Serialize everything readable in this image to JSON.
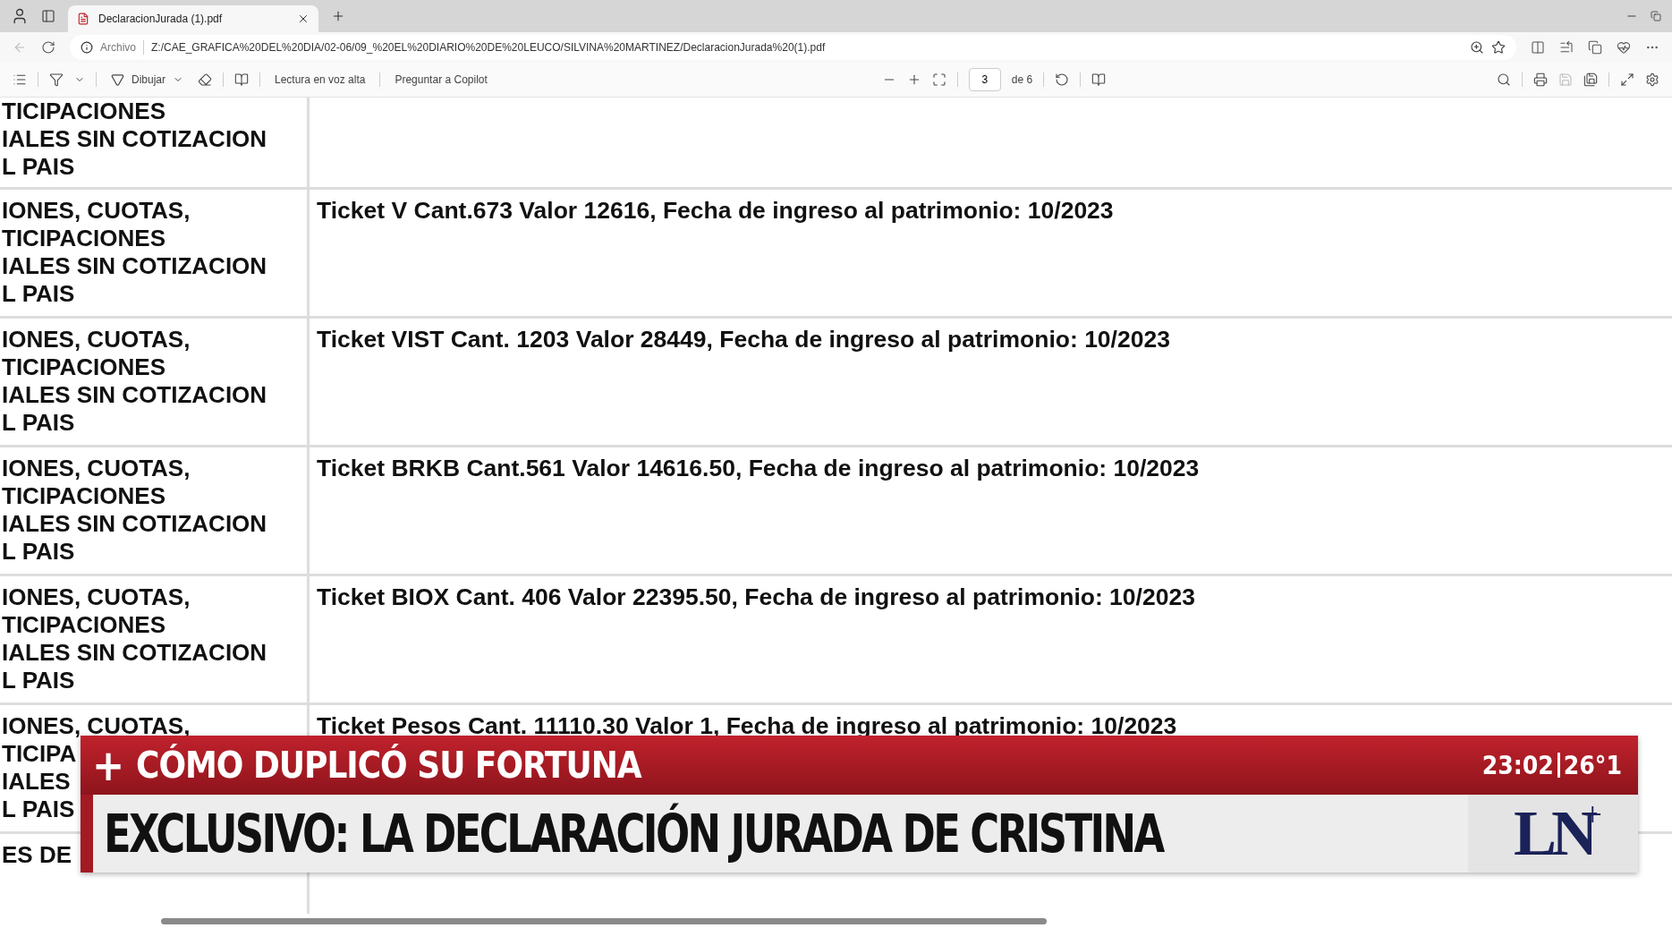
{
  "browser": {
    "tab": {
      "title": "DeclaracionJurada (1).pdf",
      "selected": true
    },
    "address": {
      "scheme_label": "Archivo",
      "url": "Z:/CAE_GRAFICA%20DEL%20DIA/02-06/09_%20EL%20DIARIO%20DE%20LEUCO/SILVINA%20MARTINEZ/DeclaracionJurada%20(1).pdf"
    }
  },
  "pdf_toolbar": {
    "draw_label": "Dibujar",
    "read_aloud": "Lectura en voz alta",
    "ask_copilot": "Preguntar a Copilot",
    "page_number": "3",
    "page_total": "de 6"
  },
  "table": {
    "rows": [
      {
        "column_1": [
          "TICIPACIONES",
          "IALES SIN COTIZACION",
          "L PAIS"
        ],
        "column_2": ""
      },
      {
        "column_1": [
          "IONES, CUOTAS,",
          "TICIPACIONES",
          "IALES SIN COTIZACION",
          "L PAIS"
        ],
        "column_2": "Ticket V Cant.673 Valor 12616, Fecha de ingreso al patrimonio: 10/2023"
      },
      {
        "column_1": [
          "IONES, CUOTAS,",
          "TICIPACIONES",
          "IALES SIN COTIZACION",
          "L PAIS"
        ],
        "column_2": "Ticket VIST Cant. 1203 Valor 28449, Fecha de ingreso al patrimonio: 10/2023"
      },
      {
        "column_1": [
          "IONES, CUOTAS,",
          "TICIPACIONES",
          "IALES SIN COTIZACION",
          "L PAIS"
        ],
        "column_2": "Ticket BRKB Cant.561 Valor 14616.50, Fecha de ingreso al patrimonio: 10/2023"
      },
      {
        "column_1": [
          "IONES, CUOTAS,",
          "TICIPACIONES",
          "IALES SIN COTIZACION",
          "L PAIS"
        ],
        "column_2": "Ticket BIOX Cant. 406 Valor 22395.50, Fecha de ingreso al patrimonio: 10/2023"
      },
      {
        "column_1": [
          "IONES, CUOTAS,",
          "TICIPA",
          "IALES",
          "L PAIS"
        ],
        "column_2": "Ticket Pesos Cant. 11110.30 Valor 1, Fecha de ingreso al patrimonio: 10/2023"
      },
      {
        "column_1": [
          "ES DE"
        ],
        "column_2": ""
      }
    ]
  },
  "tv_banner": {
    "plus": "+",
    "kicker": "CÓMO DUPLICÓ SU FORTUNA",
    "headline": "EXCLUSIVO: LA DECLARACIÓN JURADA DE CRISTINA",
    "time": "23:02",
    "temperature": "26°1",
    "logo": "LN",
    "logo_plus": "+"
  }
}
